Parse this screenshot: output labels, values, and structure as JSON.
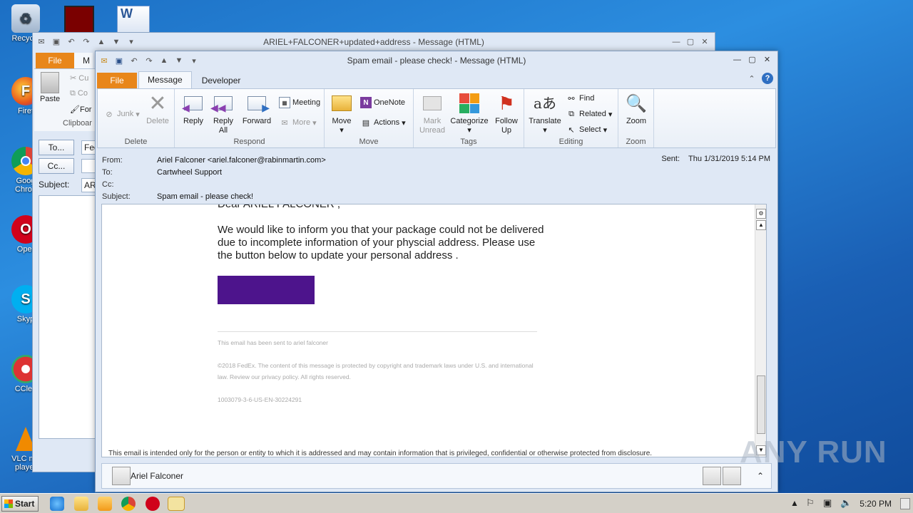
{
  "desktop": {
    "icons": [
      {
        "label": "Recycle"
      },
      {
        "label": "Firef"
      },
      {
        "label": "Goog Chron"
      },
      {
        "label": "Oper"
      },
      {
        "label": "Skyp"
      },
      {
        "label": "CClea"
      },
      {
        "label": "VLC me player"
      }
    ]
  },
  "back_window": {
    "title": "ARIEL+FALCONER+updated+address - Message (HTML)",
    "file_tab": "File",
    "msg_tab_partial": "M",
    "paste": "Paste",
    "cut": "Cu",
    "copy": "Co",
    "format": "For",
    "clipboard": "Clipboar",
    "to_button": "To...",
    "cc_button": "Cc...",
    "to_value": "Fed",
    "subject_label": "Subject:",
    "subject_value": "AR"
  },
  "window": {
    "title": "Spam email - please check!  -  Message (HTML)",
    "tabs": [
      "File",
      "Message",
      "Developer"
    ],
    "ribbon": {
      "delete_group": {
        "label": "Delete",
        "junk": "Junk",
        "delete": "Delete"
      },
      "respond_group": {
        "label": "Respond",
        "reply": "Reply",
        "reply_all": "Reply All",
        "forward": "Forward",
        "meeting": "Meeting",
        "more": "More"
      },
      "quicksteps": {
        "onenote": "OneNote",
        "actions": "Actions"
      },
      "move_group": {
        "label": "Move",
        "move": "Move"
      },
      "tags_group": {
        "label": "Tags",
        "mark_unread": "Mark Unread",
        "categorize": "Categorize",
        "follow_up": "Follow Up"
      },
      "editing_group": {
        "label": "Editing",
        "translate": "Translate",
        "find": "Find",
        "related": "Related",
        "select": "Select"
      },
      "zoom_group": {
        "label": "Zoom",
        "zoom": "Zoom"
      }
    },
    "header": {
      "from_label": "From:",
      "from_value": "Ariel Falconer <ariel.falconer@rabinmartin.com>",
      "to_label": "To:",
      "to_value": "Cartwheel Support",
      "cc_label": "Cc:",
      "subject_label": "Subject:",
      "subject_value": "Spam email - please check!",
      "sent_label": "Sent:",
      "sent_value": "Thu 1/31/2019 5:14 PM"
    },
    "body": {
      "greeting": "Dear ARIEL FALCONER ,",
      "paragraph": "We would like to inform you that your package could not be delivered due to incomplete information of your physcial address. Please use the button below to update your personal address .",
      "button_color": "#4d148c",
      "sent_to": "This email has been sent to ariel falconer",
      "copyright": "©2018 FedEx. The content of this message is protected by copyright and trademark laws under U.S. and international law. Review our privacy policy. All rights reserved.",
      "ref_code": "1003079-3-6-US-EN-30224291",
      "disclaimer": "This email is intended only for the person or entity to which it is addressed and may contain information that is privileged, confidential or otherwise protected from disclosure."
    },
    "people_pane": {
      "name": "Ariel Falconer"
    }
  },
  "taskbar": {
    "start": "Start",
    "clock": "5:20 PM"
  },
  "watermark": "ANY RUN"
}
